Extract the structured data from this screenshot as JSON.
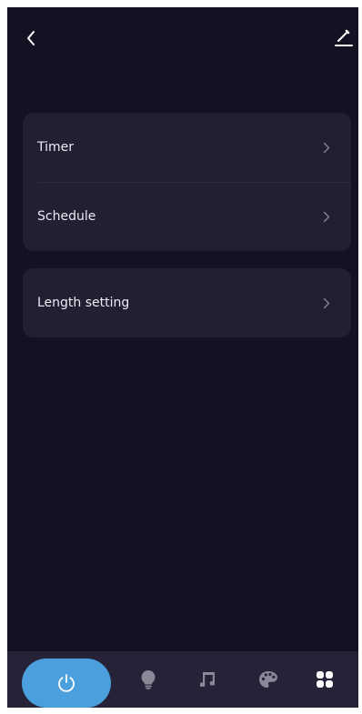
{
  "header": {
    "back_icon": "chevron-left-icon",
    "edit_icon": "pencil-icon"
  },
  "settings": {
    "group1": [
      {
        "label": "Timer",
        "icon": "chevron-right-icon"
      },
      {
        "label": "Schedule",
        "icon": "chevron-right-icon"
      }
    ],
    "group2": [
      {
        "label": "Length setting",
        "icon": "chevron-right-icon"
      }
    ]
  },
  "bottom_nav": {
    "items": [
      {
        "icon": "power-icon",
        "active": true
      },
      {
        "icon": "lightbulb-icon",
        "active": false
      },
      {
        "icon": "music-note-icon",
        "active": false
      },
      {
        "icon": "palette-icon",
        "active": false
      },
      {
        "icon": "grid-icon",
        "active": false
      }
    ]
  },
  "colors": {
    "background": "#141122",
    "card": "#221f33",
    "nav_bar": "#262338",
    "accent": "#4a9fdc",
    "text": "#eceaf2",
    "inactive_icon": "#8a8797",
    "active_icon": "#ffffff"
  }
}
